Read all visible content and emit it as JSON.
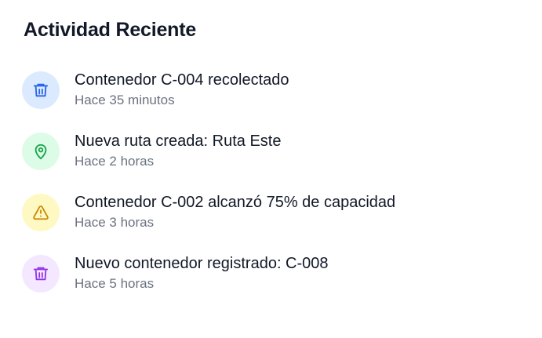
{
  "panel": {
    "title": "Actividad Reciente"
  },
  "activities": [
    {
      "title": "Contenedor C-004 recolectado",
      "time": "Hace 35 minutos",
      "icon": "trash-icon",
      "bg": "#dbeafe",
      "color": "#2563eb"
    },
    {
      "title": "Nueva ruta creada: Ruta Este",
      "time": "Hace 2 horas",
      "icon": "map-pin-icon",
      "bg": "#dcfce7",
      "color": "#16a34a"
    },
    {
      "title": "Contenedor C-002 alcanzó 75% de capacidad",
      "time": "Hace 3 horas",
      "icon": "warning-icon",
      "bg": "#fef9c3",
      "color": "#ca8a04"
    },
    {
      "title": "Nuevo contenedor registrado: C-008",
      "time": "Hace 5 horas",
      "icon": "trash-icon",
      "bg": "#f3e8ff",
      "color": "#9333ea"
    }
  ]
}
